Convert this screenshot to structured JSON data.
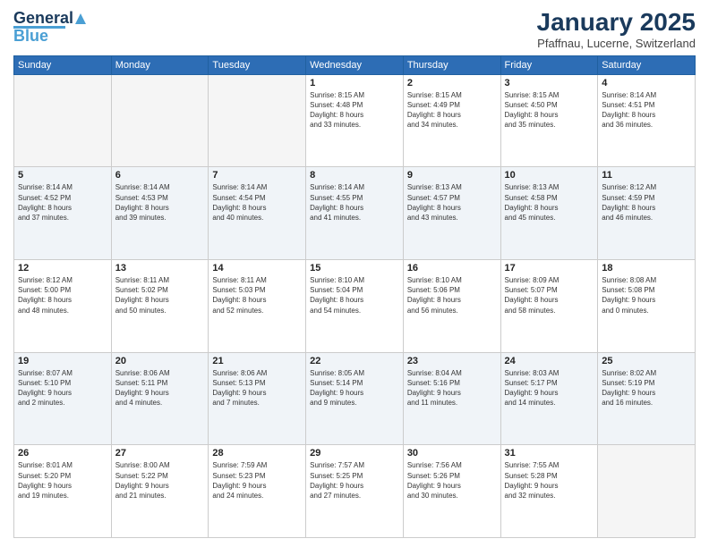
{
  "header": {
    "logo_general": "General",
    "logo_blue": "Blue",
    "title": "January 2025",
    "location": "Pfaffnau, Lucerne, Switzerland"
  },
  "days_of_week": [
    "Sunday",
    "Monday",
    "Tuesday",
    "Wednesday",
    "Thursday",
    "Friday",
    "Saturday"
  ],
  "weeks": [
    [
      {
        "day": "",
        "info": ""
      },
      {
        "day": "",
        "info": ""
      },
      {
        "day": "",
        "info": ""
      },
      {
        "day": "1",
        "info": "Sunrise: 8:15 AM\nSunset: 4:48 PM\nDaylight: 8 hours\nand 33 minutes."
      },
      {
        "day": "2",
        "info": "Sunrise: 8:15 AM\nSunset: 4:49 PM\nDaylight: 8 hours\nand 34 minutes."
      },
      {
        "day": "3",
        "info": "Sunrise: 8:15 AM\nSunset: 4:50 PM\nDaylight: 8 hours\nand 35 minutes."
      },
      {
        "day": "4",
        "info": "Sunrise: 8:14 AM\nSunset: 4:51 PM\nDaylight: 8 hours\nand 36 minutes."
      }
    ],
    [
      {
        "day": "5",
        "info": "Sunrise: 8:14 AM\nSunset: 4:52 PM\nDaylight: 8 hours\nand 37 minutes."
      },
      {
        "day": "6",
        "info": "Sunrise: 8:14 AM\nSunset: 4:53 PM\nDaylight: 8 hours\nand 39 minutes."
      },
      {
        "day": "7",
        "info": "Sunrise: 8:14 AM\nSunset: 4:54 PM\nDaylight: 8 hours\nand 40 minutes."
      },
      {
        "day": "8",
        "info": "Sunrise: 8:14 AM\nSunset: 4:55 PM\nDaylight: 8 hours\nand 41 minutes."
      },
      {
        "day": "9",
        "info": "Sunrise: 8:13 AM\nSunset: 4:57 PM\nDaylight: 8 hours\nand 43 minutes."
      },
      {
        "day": "10",
        "info": "Sunrise: 8:13 AM\nSunset: 4:58 PM\nDaylight: 8 hours\nand 45 minutes."
      },
      {
        "day": "11",
        "info": "Sunrise: 8:12 AM\nSunset: 4:59 PM\nDaylight: 8 hours\nand 46 minutes."
      }
    ],
    [
      {
        "day": "12",
        "info": "Sunrise: 8:12 AM\nSunset: 5:00 PM\nDaylight: 8 hours\nand 48 minutes."
      },
      {
        "day": "13",
        "info": "Sunrise: 8:11 AM\nSunset: 5:02 PM\nDaylight: 8 hours\nand 50 minutes."
      },
      {
        "day": "14",
        "info": "Sunrise: 8:11 AM\nSunset: 5:03 PM\nDaylight: 8 hours\nand 52 minutes."
      },
      {
        "day": "15",
        "info": "Sunrise: 8:10 AM\nSunset: 5:04 PM\nDaylight: 8 hours\nand 54 minutes."
      },
      {
        "day": "16",
        "info": "Sunrise: 8:10 AM\nSunset: 5:06 PM\nDaylight: 8 hours\nand 56 minutes."
      },
      {
        "day": "17",
        "info": "Sunrise: 8:09 AM\nSunset: 5:07 PM\nDaylight: 8 hours\nand 58 minutes."
      },
      {
        "day": "18",
        "info": "Sunrise: 8:08 AM\nSunset: 5:08 PM\nDaylight: 9 hours\nand 0 minutes."
      }
    ],
    [
      {
        "day": "19",
        "info": "Sunrise: 8:07 AM\nSunset: 5:10 PM\nDaylight: 9 hours\nand 2 minutes."
      },
      {
        "day": "20",
        "info": "Sunrise: 8:06 AM\nSunset: 5:11 PM\nDaylight: 9 hours\nand 4 minutes."
      },
      {
        "day": "21",
        "info": "Sunrise: 8:06 AM\nSunset: 5:13 PM\nDaylight: 9 hours\nand 7 minutes."
      },
      {
        "day": "22",
        "info": "Sunrise: 8:05 AM\nSunset: 5:14 PM\nDaylight: 9 hours\nand 9 minutes."
      },
      {
        "day": "23",
        "info": "Sunrise: 8:04 AM\nSunset: 5:16 PM\nDaylight: 9 hours\nand 11 minutes."
      },
      {
        "day": "24",
        "info": "Sunrise: 8:03 AM\nSunset: 5:17 PM\nDaylight: 9 hours\nand 14 minutes."
      },
      {
        "day": "25",
        "info": "Sunrise: 8:02 AM\nSunset: 5:19 PM\nDaylight: 9 hours\nand 16 minutes."
      }
    ],
    [
      {
        "day": "26",
        "info": "Sunrise: 8:01 AM\nSunset: 5:20 PM\nDaylight: 9 hours\nand 19 minutes."
      },
      {
        "day": "27",
        "info": "Sunrise: 8:00 AM\nSunset: 5:22 PM\nDaylight: 9 hours\nand 21 minutes."
      },
      {
        "day": "28",
        "info": "Sunrise: 7:59 AM\nSunset: 5:23 PM\nDaylight: 9 hours\nand 24 minutes."
      },
      {
        "day": "29",
        "info": "Sunrise: 7:57 AM\nSunset: 5:25 PM\nDaylight: 9 hours\nand 27 minutes."
      },
      {
        "day": "30",
        "info": "Sunrise: 7:56 AM\nSunset: 5:26 PM\nDaylight: 9 hours\nand 30 minutes."
      },
      {
        "day": "31",
        "info": "Sunrise: 7:55 AM\nSunset: 5:28 PM\nDaylight: 9 hours\nand 32 minutes."
      },
      {
        "day": "",
        "info": ""
      }
    ]
  ]
}
